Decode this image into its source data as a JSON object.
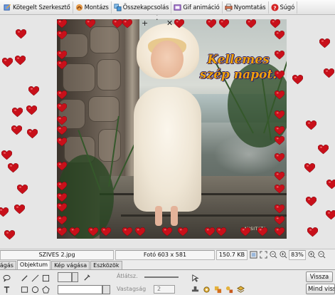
{
  "toolbar": {
    "items": [
      {
        "label": "Kötegelt Szerkesztő",
        "icon": "batch-edit-icon",
        "color": "#3a6fc4"
      },
      {
        "label": "Montázs",
        "icon": "montage-icon",
        "color": "#c8631d"
      },
      {
        "label": "Összekapcsolás",
        "icon": "combine-icon",
        "color": "#2f8bd0"
      },
      {
        "label": "Gif animáció",
        "icon": "gif-animation-icon",
        "color": "#7c4bb0"
      },
      {
        "label": "Nyomtatás",
        "icon": "print-icon",
        "color": "#c14c2c"
      },
      {
        "label": "Súgó",
        "icon": "help-icon",
        "color": "#cc1f1f"
      }
    ]
  },
  "canvas": {
    "greeting_line1": "Kellemes",
    "greeting_line2": "szép napot.",
    "watermark": "MISITATA",
    "heart_color": "#c8101a"
  },
  "statusbar": {
    "filename": "SZIVES 2.jpg",
    "photo_size": "Fotó 603 x 581",
    "file_size": "150.7 KB",
    "zoom": "83%"
  },
  "tabs": [
    {
      "label": "Vágás",
      "active": false
    },
    {
      "label": "Objektum",
      "active": true
    },
    {
      "label": "Kép vágása",
      "active": false
    },
    {
      "label": "Eszközök",
      "active": false
    }
  ],
  "panel": {
    "opacity_label": "Átlátsz.",
    "thickness_label": "Vastagság",
    "thickness_value": "2",
    "reset_label": "Vissza",
    "reset_all_label": "Mind vissza"
  }
}
